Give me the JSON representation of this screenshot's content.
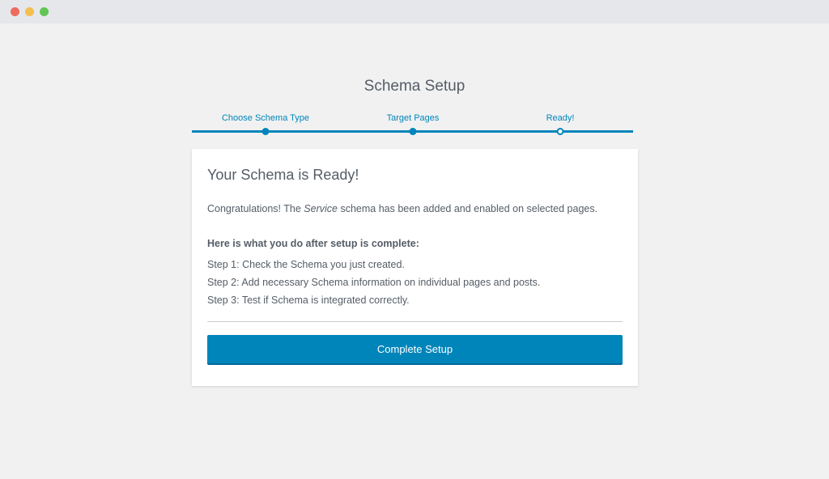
{
  "window": {
    "traffic_lights": [
      "close",
      "minimize",
      "maximize"
    ]
  },
  "page_title": "Schema Setup",
  "steps": [
    {
      "label": "Choose Schema Type",
      "status": "completed"
    },
    {
      "label": "Target Pages",
      "status": "completed"
    },
    {
      "label": "Ready!",
      "status": "current"
    }
  ],
  "card": {
    "heading": "Your Schema is Ready!",
    "intro_before": "Congratulations! The ",
    "intro_emphasis": "Service",
    "intro_after": " schema has been added and enabled on selected pages.",
    "next_heading": "Here is what you do after setup is complete:",
    "next_steps": [
      "Step 1: Check the Schema you just created.",
      "Step 2: Add necessary Schema information on individual pages and posts.",
      "Step 3: Test if Schema is integrated correctly."
    ],
    "button_label": "Complete Setup"
  },
  "colors": {
    "accent": "#0085ba",
    "background": "#f1f1f1",
    "card": "#ffffff",
    "text": "#555d66"
  }
}
